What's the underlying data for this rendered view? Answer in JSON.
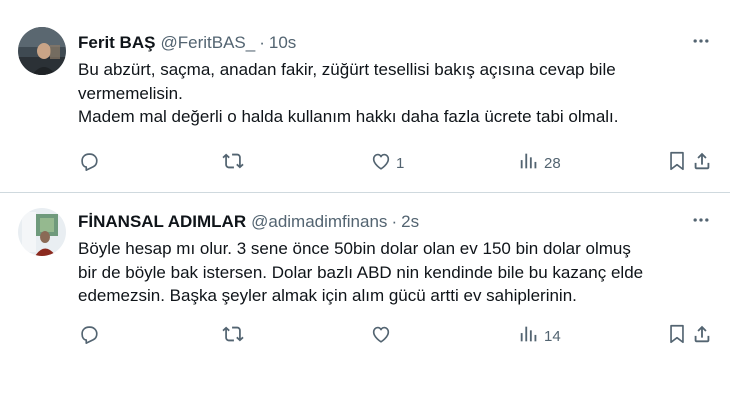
{
  "tweets": [
    {
      "name": "Ferit BAŞ",
      "handle": "@FeritBAS_",
      "separator": "·",
      "time": "10s",
      "text": "Bu abzürt, saçma, anadan fakir, züğürt tesellisi bakış açısına cevap bile\nvermemelisin.\nMadem mal değerli o halda kullanım hakkı daha fazla ücrete tabi olmalı.",
      "likes": "1",
      "views": "28",
      "icons": [
        "reply-icon",
        "retweet-icon",
        "like-icon",
        "views-icon",
        "bookmark-icon",
        "share-icon",
        "more-icon"
      ]
    },
    {
      "name": "FİNANSAL ADIMLAR",
      "handle": "@adimadimfinans",
      "separator": "·",
      "time": "2s",
      "text": "Böyle hesap mı olur. 3 sene önce 50bin dolar olan ev 150 bin dolar olmuş\nbir de böyle bak istersen. Dolar bazlı ABD nin kendinde bile bu kazanç elde\nedemezsin. Başka şeyler almak için alım gücü artti ev sahiplerinin.",
      "likes": "",
      "views": "14",
      "icons": [
        "reply-icon",
        "retweet-icon",
        "like-icon",
        "views-icon",
        "bookmark-icon",
        "share-icon",
        "more-icon"
      ]
    }
  ],
  "colors": {
    "text": "#0f1419",
    "muted": "#536471",
    "divider": "#cfd9de"
  }
}
